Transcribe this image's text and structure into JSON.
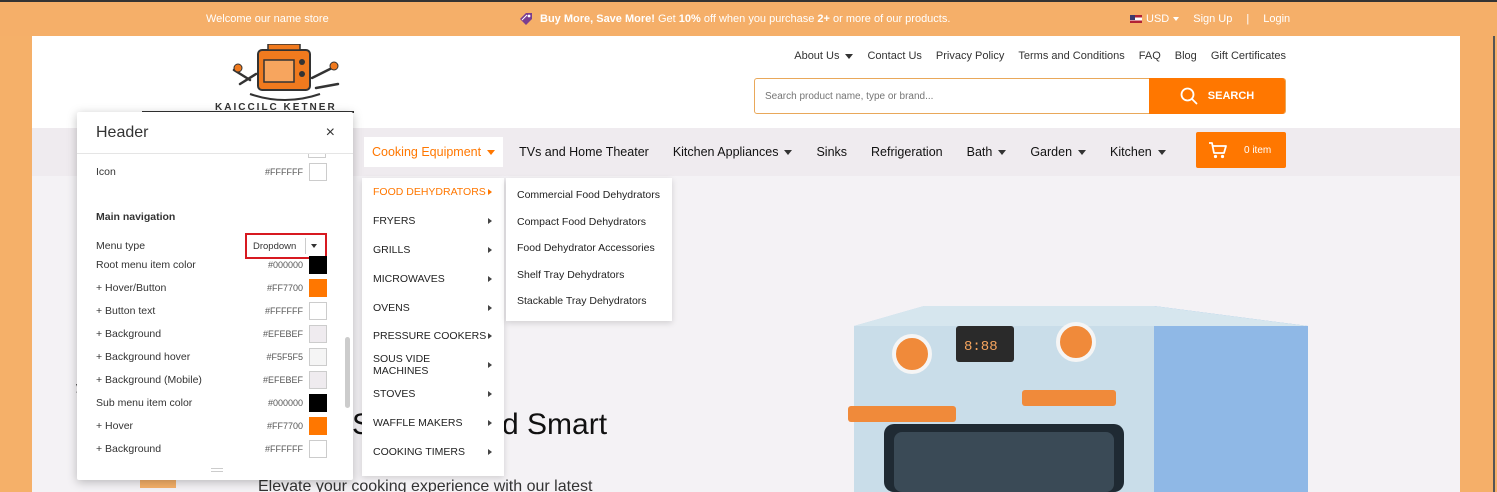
{
  "topbar": {
    "welcome": "Welcome our name store",
    "promo_bold": "Buy More, Save More!",
    "promo_pre": "Get",
    "promo_percent": "10%",
    "promo_mid": "off when you purchase",
    "promo_qty": "2+",
    "promo_post": "or more of our products.",
    "currency": "USD",
    "signup": "Sign Up",
    "separator": "|",
    "login": "Login"
  },
  "logo": {
    "text": "KAICCILC KETNER"
  },
  "toplinks": [
    {
      "label": "About Us"
    },
    {
      "label": "Contact Us"
    },
    {
      "label": "Privacy Policy"
    },
    {
      "label": "Terms and Conditions"
    },
    {
      "label": "FAQ"
    },
    {
      "label": "Blog"
    },
    {
      "label": "Gift Certificates"
    }
  ],
  "search": {
    "placeholder": "Search product name, type or brand...",
    "button": "SEARCH"
  },
  "nav": {
    "items": [
      {
        "label": "Cooking Equipment"
      },
      {
        "label": "TVs and Home Theater"
      },
      {
        "label": "Kitchen Appliances"
      },
      {
        "label": "Sinks"
      },
      {
        "label": "Refrigeration"
      },
      {
        "label": "Bath"
      },
      {
        "label": "Garden"
      },
      {
        "label": "Kitchen"
      }
    ],
    "cart": "0 item"
  },
  "submenu": [
    "FOOD DEHYDRATORS",
    "FRYERS",
    "GRILLS",
    "MICROWAVES",
    "OVENS",
    "PRESSURE COOKERS",
    "SOUS VIDE MACHINES",
    "STOVES",
    "WAFFLE MAKERS",
    "COOKING TIMERS"
  ],
  "submenu2": [
    "Commercial Food Dehydrators",
    "Compact Food Dehydrators",
    "Food Dehydrator Accessories",
    "Shelf Tray Dehydrators",
    "Stackable Tray Dehydrators"
  ],
  "hero": {
    "title": "S",
    "title_end": "d Smart",
    "subtitle": "Elevate your cooking experience with our latest",
    "side_letter": "y"
  },
  "panel": {
    "title": "Header",
    "close": "×",
    "icon_row": {
      "label": "Icon",
      "value": "#FFFFFF"
    },
    "section": "Main navigation",
    "menu_type": {
      "label": "Menu type",
      "value": "Dropdown"
    },
    "rows": [
      {
        "label": "Root menu item color",
        "value": "#000000"
      },
      {
        "label": "+ Hover/Button",
        "value": "#FF7700"
      },
      {
        "label": "+ Button text",
        "value": "#FFFFFF"
      },
      {
        "label": "+ Background",
        "value": "#EFEBEF"
      },
      {
        "label": "+ Background hover",
        "value": "#F5F5F5"
      },
      {
        "label": "+ Background (Mobile)",
        "value": "#EFEBEF"
      },
      {
        "label": "Sub menu item color",
        "value": "#000000"
      },
      {
        "label": "+ Hover",
        "value": "#FF7700"
      },
      {
        "label": "+ Background",
        "value": "#FFFFFF"
      }
    ]
  }
}
